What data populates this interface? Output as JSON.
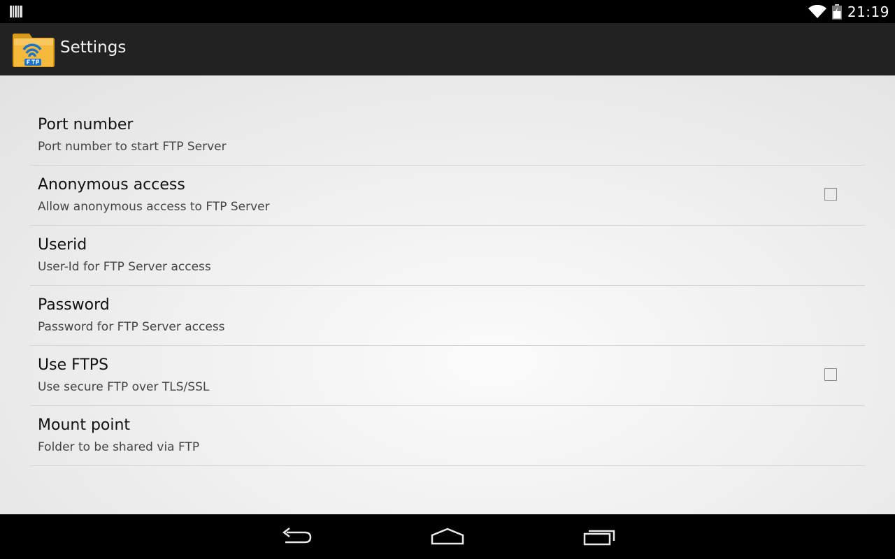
{
  "status_bar": {
    "time": "21:19",
    "icons": [
      "barcode-icon",
      "wifi-icon",
      "battery-icon"
    ]
  },
  "action_bar": {
    "app_icon": "ftp-folder-icon",
    "title": "Settings"
  },
  "preferences": [
    {
      "title": "Port number",
      "summary": "Port number to start FTP Server",
      "checkbox": false
    },
    {
      "title": "Anonymous access",
      "summary": "Allow anonymous access to FTP Server",
      "checkbox": true,
      "checked": false
    },
    {
      "title": "Userid",
      "summary": "User-Id for FTP Server access",
      "checkbox": false
    },
    {
      "title": "Password",
      "summary": "Password for FTP Server access",
      "checkbox": false
    },
    {
      "title": "Use FTPS",
      "summary": "Use secure FTP over TLS/SSL",
      "checkbox": true,
      "checked": false
    },
    {
      "title": "Mount point",
      "summary": "Folder to be shared via FTP",
      "checkbox": false
    }
  ],
  "nav_bar": {
    "buttons": [
      "back-icon",
      "home-icon",
      "recent-apps-icon"
    ]
  },
  "colors": {
    "action_bar": "#222222",
    "status_bar": "#000000",
    "divider": "#d4d4d4"
  }
}
